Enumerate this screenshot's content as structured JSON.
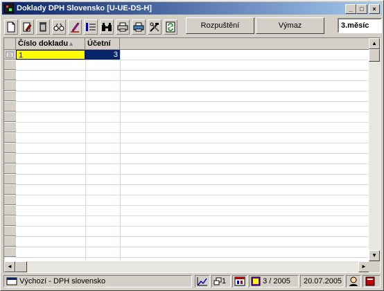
{
  "window": {
    "title": "Doklady DPH Slovensko [U-UE-DS-H]",
    "controls": {
      "minimize": "_",
      "maximize": "□",
      "close": "×"
    }
  },
  "toolbar": {
    "icons": [
      "new-document-icon",
      "edit-icon",
      "delete-icon",
      "view-icon",
      "pen-icon",
      "list-icon",
      "binoculars-icon",
      "print-icon",
      "print-preview-icon",
      "tools-icon",
      "refresh-icon"
    ],
    "rozpusteni_label": "Rozpuštění",
    "vymaz_label": "Výmaz",
    "period_value": "3.měsíc"
  },
  "grid": {
    "columns": [
      {
        "label": "Číslo dokladu",
        "sort_indicator": "▲"
      },
      {
        "label": "Účetní"
      }
    ],
    "rows": [
      {
        "cislo_dokladu": "1",
        "ucetni": "3"
      }
    ]
  },
  "statusbar": {
    "view_label": "Výchozí - DPH slovensko",
    "window_count": "1",
    "period": "3 / 2005",
    "date": "20.07.2005"
  },
  "colors": {
    "title_start": "#0a246a",
    "title_end": "#a6caf0",
    "selected_cell": "#ffff00",
    "selected_row_highlight": "#0a246a"
  }
}
